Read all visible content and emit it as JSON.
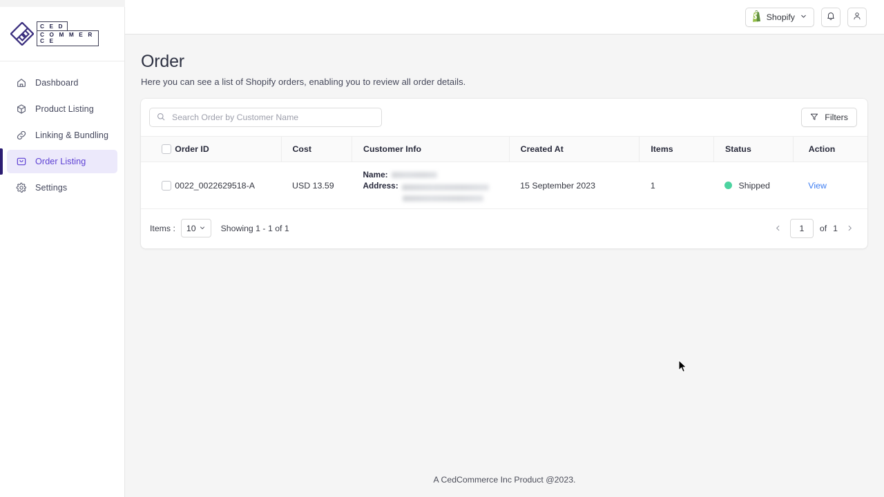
{
  "brand": {
    "logo_line1": "C E D",
    "logo_line2": "C O M M E R C E",
    "logo_icon": "ced-diamond-logo"
  },
  "sidebar": {
    "items": [
      {
        "label": "Dashboard",
        "icon": "home-icon",
        "active": false
      },
      {
        "label": "Product Listing",
        "icon": "cube-icon",
        "active": false
      },
      {
        "label": "Linking & Bundling",
        "icon": "link-icon",
        "active": false
      },
      {
        "label": "Order Listing",
        "icon": "bag-icon",
        "active": true
      },
      {
        "label": "Settings",
        "icon": "gear-icon",
        "active": false
      }
    ],
    "active_bg": "#ece9fb",
    "active_color": "#5c3fd3",
    "active_bar": "#2c1d72"
  },
  "topbar": {
    "shopify_button_label": "Shopify",
    "shopify_icon": "shopify-bag-icon",
    "shopify_icon_color": "#95bf47",
    "chevron_icon": "chevron-down-icon",
    "notification_icon": "bell-icon",
    "account_icon": "user-icon"
  },
  "page": {
    "title": "Order",
    "subtitle": "Here you can see a list of Shopify orders, enabling you to review all order details."
  },
  "search": {
    "placeholder": "Search Order by Customer Name",
    "value": "",
    "icon": "search-icon"
  },
  "filters": {
    "label": "Filters",
    "icon": "filter-funnel-icon"
  },
  "table": {
    "columns": [
      {
        "key": "select",
        "label": ""
      },
      {
        "key": "order_id",
        "label": "Order ID"
      },
      {
        "key": "cost",
        "label": "Cost"
      },
      {
        "key": "customer",
        "label": "Customer Info"
      },
      {
        "key": "created",
        "label": "Created At"
      },
      {
        "key": "items",
        "label": "Items"
      },
      {
        "key": "status",
        "label": "Status"
      },
      {
        "key": "action",
        "label": "Action"
      }
    ],
    "customer_labels": {
      "name": "Name:",
      "address": "Address:"
    },
    "rows": [
      {
        "order_id": "0022_0022629518-A",
        "cost": "USD 13.59",
        "customer_name_redacted": true,
        "customer_address_redacted": true,
        "created_at": "15 September 2023",
        "items": "1",
        "status": "Shipped",
        "status_color": "#4cd3a0",
        "action": "View"
      }
    ]
  },
  "pagination": {
    "items_label": "Items :",
    "page_size": "10",
    "showing_text": "Showing 1 - 1 of 1",
    "current_page": "1",
    "of_label": "of",
    "total_pages": "1",
    "prev_icon": "chevron-left-icon",
    "next_icon": "chevron-right-icon"
  },
  "footer": {
    "text": "A CedCommerce Inc Product @2023."
  }
}
